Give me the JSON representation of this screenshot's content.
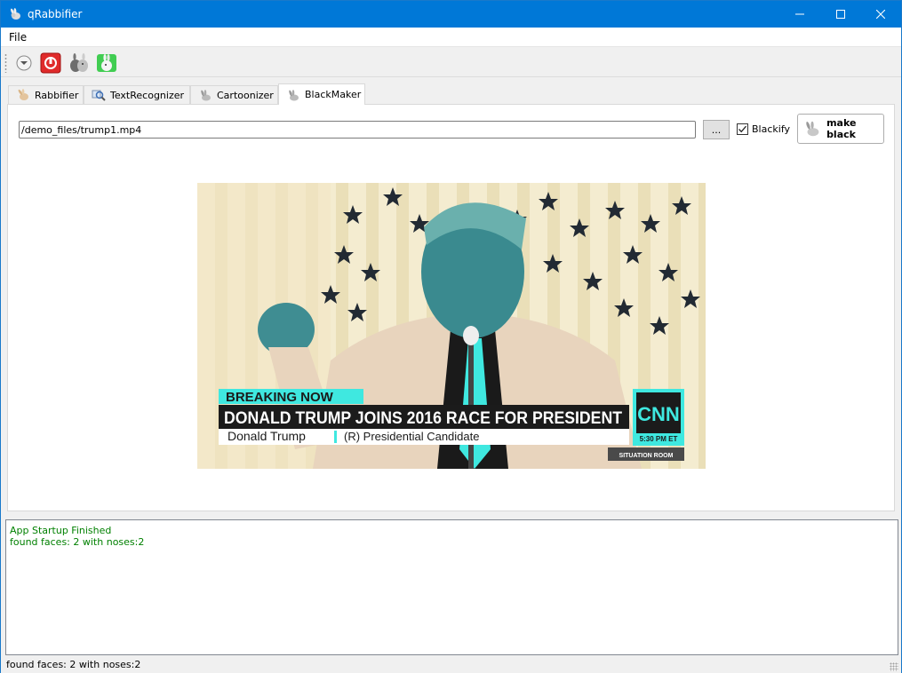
{
  "window": {
    "title": "qRabbifier",
    "controls": [
      "minimize",
      "maximize",
      "close"
    ]
  },
  "menu": {
    "items": [
      "File"
    ]
  },
  "toolbar": {
    "buttons": [
      {
        "icon": "dropdown-circle-icon"
      },
      {
        "icon": "power-icon"
      },
      {
        "icon": "rabbits-icon"
      },
      {
        "icon": "qt-rabbit-icon"
      }
    ]
  },
  "tabs": [
    {
      "label": "Rabbifier",
      "icon": "rabbit-icon",
      "active": false
    },
    {
      "label": "TextRecognizer",
      "icon": "magnifier-icon",
      "active": false
    },
    {
      "label": "Cartoonizer",
      "icon": "rabbit-icon",
      "active": false
    },
    {
      "label": "BlackMaker",
      "icon": "rabbit-icon",
      "active": true
    }
  ],
  "blackmaker": {
    "file_path": "/demo_files/trump1.mp4",
    "browse_label": "...",
    "blackify_label": "Blackify",
    "blackify_checked": true,
    "make_black_label": "make black"
  },
  "video": {
    "breaking_label": "BREAKING NOW",
    "headline": "DONALD TRUMP JOINS 2016 RACE FOR PRESIDENT",
    "name": "Donald Trump",
    "subtitle": "(R) Presidential Candidate",
    "network": "CNN",
    "time": "5:30 PM ET",
    "program": "SITUATION ROOM"
  },
  "log": {
    "lines": [
      "App Startup Finished",
      "found faces: 2 with noses:2"
    ]
  },
  "status": {
    "message": "found faces: 2 with noses:2"
  },
  "colors": {
    "titlebar": "#0078d7",
    "log_text": "#008000",
    "banner_teal": "#3fe8e0"
  }
}
